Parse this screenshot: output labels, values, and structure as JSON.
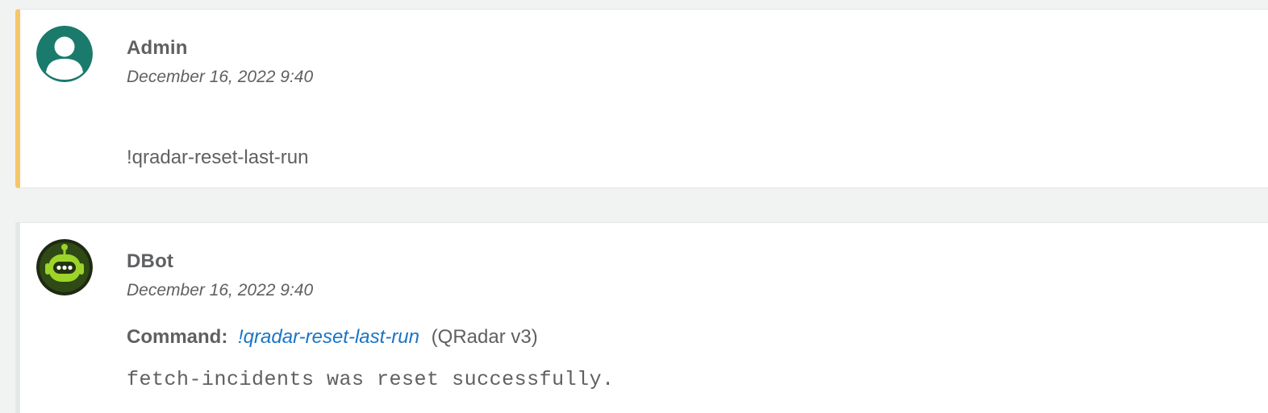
{
  "entries": [
    {
      "author": "Admin",
      "timestamp": "December 16, 2022 9:40",
      "message": "!qradar-reset-last-run",
      "avatar_icon": "user-icon",
      "accent_color": "#f6c66a"
    },
    {
      "author": "DBot",
      "timestamp": "December 16, 2022 9:40",
      "command_label": "Command:",
      "command_name": "!qradar-reset-last-run",
      "command_integration": "(QRadar v3)",
      "output": "fetch-incidents was reset successfully.",
      "avatar_icon": "robot-icon",
      "link_color": "#1b74c5"
    }
  ]
}
